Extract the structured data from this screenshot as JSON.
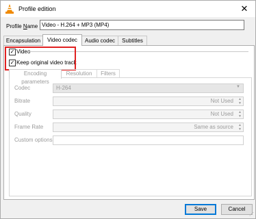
{
  "window": {
    "title": "Profile edition",
    "close_glyph": "✕",
    "icon": "vlc-cone-icon"
  },
  "profile_name": {
    "label": "Profile Name",
    "value": "Video - H.264 + MP3 (MP4)"
  },
  "tabs": [
    {
      "label": "Encapsulation",
      "active": false
    },
    {
      "label": "Video codec",
      "active": true
    },
    {
      "label": "Audio codec",
      "active": false
    },
    {
      "label": "Subtitles",
      "active": false
    }
  ],
  "video_codec": {
    "video_checkbox": {
      "label": "Video",
      "checked": true
    },
    "keep_original": {
      "label": "Keep original video track",
      "checked": true
    },
    "highlight_color": "#e02020",
    "subtabs": [
      {
        "label": "Encoding parameters",
        "active": true
      },
      {
        "label": "Resolution",
        "active": false
      },
      {
        "label": "Filters",
        "active": false
      }
    ],
    "fields": {
      "codec": {
        "label": "Codec",
        "value": "H-264"
      },
      "bitrate": {
        "label": "Bitrate",
        "value": "Not Used"
      },
      "quality": {
        "label": "Quality",
        "value": "Not Used"
      },
      "frame_rate": {
        "label": "Frame Rate",
        "value": "Same as source"
      },
      "custom_options": {
        "label": "Custom options",
        "value": ""
      }
    }
  },
  "footer": {
    "save_label": "Save",
    "cancel_label": "Cancel"
  },
  "check_glyph": "✓",
  "accent_color": "#0078d7"
}
